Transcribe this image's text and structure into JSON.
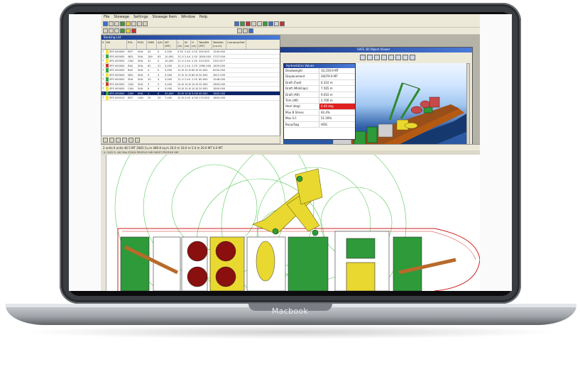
{
  "laptop": {
    "brand": "Macbook"
  },
  "app": {
    "menu": [
      "File",
      "Stowage",
      "Settings",
      "Stowage Item",
      "Window",
      "Help"
    ],
    "booking_list": {
      "title": "Booking List",
      "columns": [
        "S",
        "BK",
        "POL",
        "POD",
        "GMB",
        "A/H",
        "WT (MT)",
        "L (m)",
        "W (m)",
        "H (m)",
        "TotalWt (MT)",
        "TotalVol (cu.m)",
        "Commod.Ref"
      ],
      "rows": [
        [
          "T",
          "SPS 000000",
          "ENT",
          "SHA",
          "42",
          "0",
          "5,000",
          "5.50",
          "2.44",
          "2.50",
          "300.000",
          "1540.000"
        ],
        [
          "T",
          "SPS 000000",
          "WEL",
          "SHA",
          "180",
          "63",
          "10,000",
          "12.19",
          "2.44",
          "2.50",
          "1800.000",
          "2707.004"
        ],
        [
          "T",
          "SPS 000000",
          "CAN",
          "SHA",
          "31",
          "0",
          "10,000",
          "12.19",
          "2.44",
          "2.50",
          "310.000",
          "2307.677"
        ],
        [
          "T",
          "SPS 000000",
          "RAS",
          "SHA",
          "62",
          "21",
          "3,000",
          "12.19",
          "2.44",
          "2.50",
          "1980.000",
          "1629.000"
        ],
        [
          "T",
          "SPS 000000",
          "RAS",
          "SHA",
          "4",
          "0",
          "5,000",
          "12.50",
          "12.50",
          "60.000",
          "20.000",
          "6250.000"
        ],
        [
          "T",
          "SPS 000000",
          "WEL",
          "SHA",
          "9",
          "4",
          "5,000",
          "12.50",
          "12.50",
          "60.000",
          "20.000",
          "2812.500"
        ],
        [
          "T",
          "SPS 000000",
          "SHA",
          "SHA",
          "20",
          "4",
          "3,000",
          "12.19",
          "2.44",
          "2.50",
          "60.000",
          "1548.000"
        ],
        [
          "T",
          "SPS 000000",
          "CAN",
          "SHA",
          "5",
          "2",
          "5,000",
          "24.00",
          "10.00",
          "10.000",
          "20.000",
          "1800.000"
        ],
        [
          "T",
          "SPS 000000",
          "CAN",
          "SHA",
          "6",
          "4",
          "5,000",
          "24.00",
          "10.00",
          "10.000",
          "20.000",
          "1800.000"
        ],
        [
          "T",
          "SPS 000000",
          "CAN",
          "SHA",
          "1",
          "0",
          "20,000",
          "20.00",
          "10.00",
          "3.000",
          "40.000",
          "1800.000"
        ],
        [
          "T",
          "SPS 000010",
          "ENT",
          "CAN",
          "25",
          "25",
          "7,000",
          "12.00",
          "2.00",
          "4.000",
          "175.000",
          "1800.000"
        ]
      ],
      "selected_row": 9,
      "row_colors": [
        "#f4e24a",
        "#3aa34a",
        "#f4e24a",
        "#d03a2a",
        "#3aa34a",
        "#f4e24a",
        "#3aa34a",
        "#d03a2a",
        "#f4e24a",
        "#3aa34a",
        "#f4e24a"
      ]
    },
    "view3d": {
      "title": "SAFE 3D Object Viewer"
    },
    "hydrostatics": {
      "title": "Hydrostatics Values",
      "rows": [
        {
          "k": "Deadweight",
          "v": "10,159.9 MT"
        },
        {
          "k": "Displacement",
          "v": "20079.9 MT"
        },
        {
          "k": "Draft (Fwd)",
          "v": "6.310 m"
        },
        {
          "k": "Draft (Midships)",
          "v": "7.565 m"
        },
        {
          "k": "Draft (Aft)",
          "v": "9.010 m"
        },
        {
          "k": "Trim (Aft)",
          "v": "2.700 m"
        },
        {
          "k": "Heel (deg)",
          "v": "0.40 deg",
          "alert": true
        },
        {
          "k": "Max B Stress",
          "v": "92.4%"
        },
        {
          "k": "Max S.F.",
          "v": "51.59%"
        },
        {
          "k": "Buoy/Sag",
          "v": "HOG"
        }
      ]
    },
    "status": "2 units  0 units  46.5 MT  2083 Cu.m  480.8 sq.m  20.0 m  18.0 m  5.0 m  20.0 MT  0.0 MT",
    "plan_caption": "X:  3.63  Y:  -46.76m  STACK PROFILE  HIR  SHEET PROFILE  HIR"
  }
}
